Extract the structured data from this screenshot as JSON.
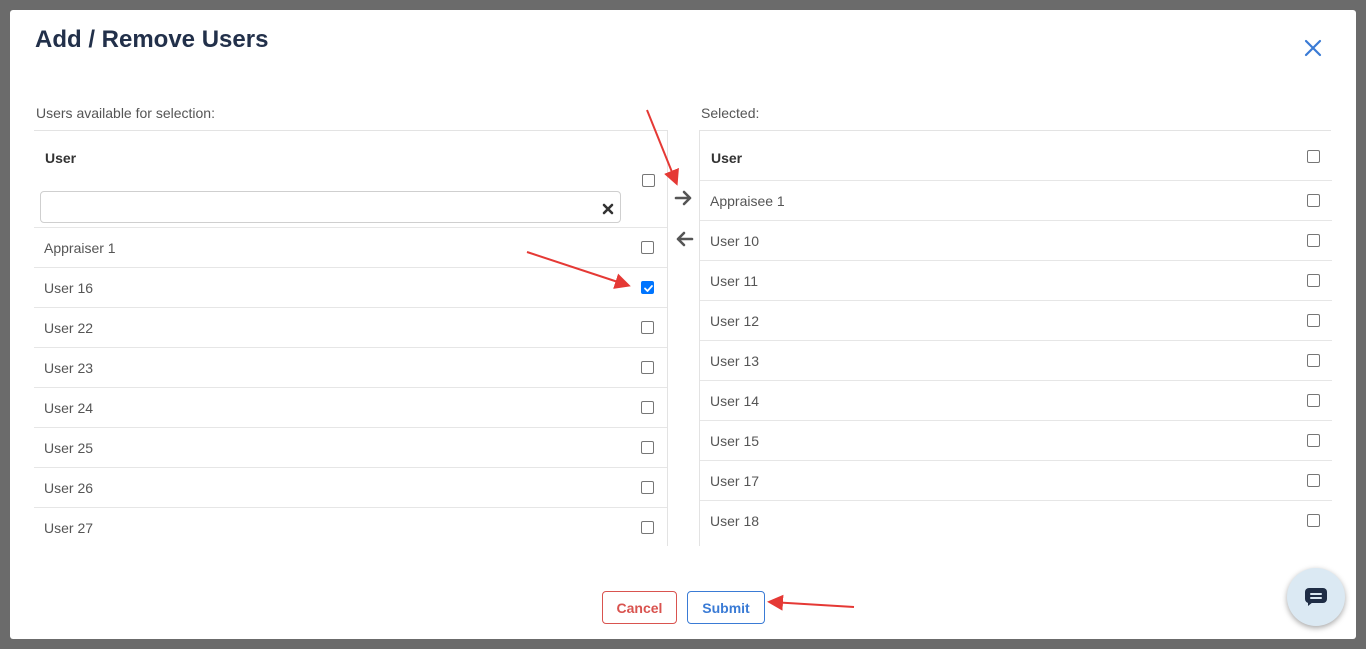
{
  "modal": {
    "title": "Add / Remove Users",
    "close_icon": "close-icon"
  },
  "available": {
    "label": "Users available for selection:",
    "header": "User",
    "search": {
      "value": "",
      "placeholder": ""
    },
    "select_all_checked": false,
    "rows": [
      {
        "label": "Appraiser 1",
        "checked": false
      },
      {
        "label": "User 16",
        "checked": true
      },
      {
        "label": "User 22",
        "checked": false
      },
      {
        "label": "User 23",
        "checked": false
      },
      {
        "label": "User 24",
        "checked": false
      },
      {
        "label": "User 25",
        "checked": false
      },
      {
        "label": "User 26",
        "checked": false
      },
      {
        "label": "User 27",
        "checked": false
      }
    ]
  },
  "selected": {
    "label": "Selected:",
    "header": "User",
    "select_all_checked": false,
    "rows": [
      {
        "label": "Appraisee 1",
        "checked": false
      },
      {
        "label": "User 10",
        "checked": false
      },
      {
        "label": "User 11",
        "checked": false
      },
      {
        "label": "User 12",
        "checked": false
      },
      {
        "label": "User 13",
        "checked": false
      },
      {
        "label": "User 14",
        "checked": false
      },
      {
        "label": "User 15",
        "checked": false
      },
      {
        "label": "User 17",
        "checked": false
      },
      {
        "label": "User 18",
        "checked": false
      }
    ]
  },
  "transfer": {
    "add_icon": "arrow-right-icon",
    "remove_icon": "arrow-left-icon"
  },
  "footer": {
    "cancel_label": "Cancel",
    "submit_label": "Submit"
  },
  "chat": {
    "icon": "chat-icon"
  },
  "colors": {
    "title": "#22304a",
    "cancel": "#d9534f",
    "submit": "#3a7bd5",
    "annotation": "#e53935",
    "checkbox_checked": "#0075ff"
  }
}
